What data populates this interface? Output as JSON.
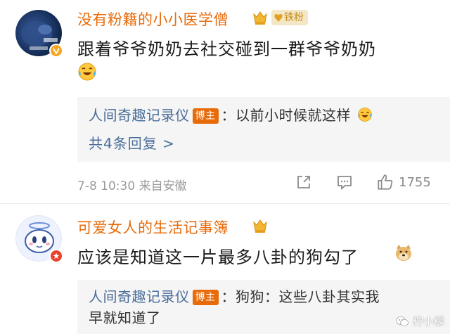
{
  "comments": [
    {
      "username": "没有粉籍的小小医学僧",
      "fans_badge": "铁粉",
      "text": "跟着爷爷奶奶去社交碰到一群爷爷奶奶",
      "emoji": "laughing-tears-emoji",
      "reply": {
        "author": "人间奇趣记录仪",
        "tag": "博主",
        "text": "：以前小时候就这样",
        "emoji": "laughing-emoji"
      },
      "more_replies": "共4条回复 >",
      "meta": "7-8 10:30  来自安徽",
      "like_count": "1755"
    },
    {
      "username": "可爱女人的生活记事簿",
      "text": "应该是知道这一片最多八卦的狗勾了",
      "emoji": "doge-emoji",
      "reply": {
        "author": "人间奇趣记录仪",
        "tag": "博主",
        "text_line1": "：狗狗：这些八卦其实我",
        "text_line2": "早就知道了"
      }
    }
  ],
  "watermark": "柠小檬",
  "colors": {
    "username": "#e86b0a",
    "reply_author": "#4a6d9a",
    "blogger_tag": "#e86b0a",
    "meta": "#9b9b9b"
  }
}
